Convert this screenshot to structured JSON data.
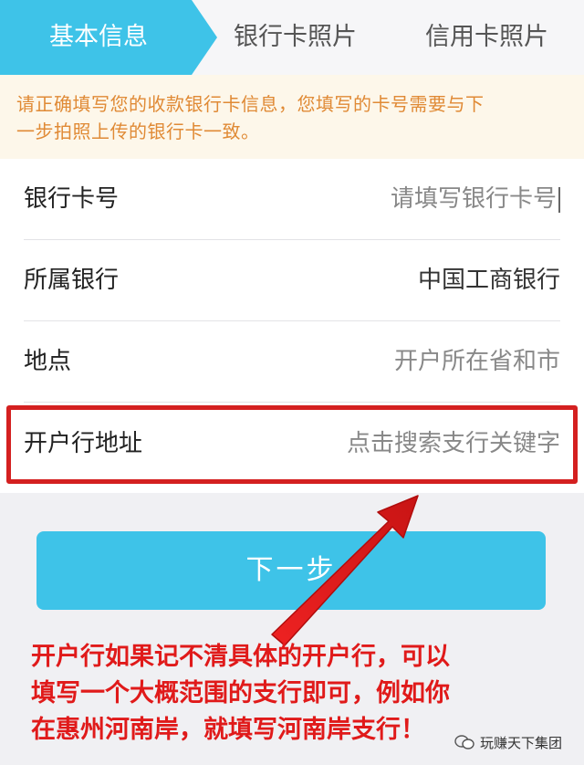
{
  "steps": [
    {
      "label": "基本信息",
      "active": true
    },
    {
      "label": "银行卡照片",
      "active": false
    },
    {
      "label": "信用卡照片",
      "active": false
    }
  ],
  "notice": {
    "line1": "请正确填写您的收款银行卡信息，您填写的卡号需要与下",
    "line2": "一步拍照上传的银行卡一致。"
  },
  "form": {
    "rows": [
      {
        "label": "银行卡号",
        "placeholder": "请填写银行卡号"
      },
      {
        "label": "所属银行",
        "value": "中国工商银行"
      },
      {
        "label": "地点",
        "placeholder": "开户所在省和市"
      },
      {
        "label": "开户行地址",
        "placeholder": "点击搜索支行关键字"
      }
    ]
  },
  "next_button": {
    "label": "下一步"
  },
  "annotation": {
    "line1": "开户行如果记不清具体的开户行，可以",
    "line2": "填写一个大概范围的支行即可，例如你",
    "line3": "在惠州河南岸，就填写河南岸支行！"
  },
  "watermark": {
    "text": "玩赚天下集团"
  },
  "colors": {
    "accent": "#3ec3e8",
    "annotation_red": "#e01a1a",
    "notice_orange": "#e08a35"
  }
}
